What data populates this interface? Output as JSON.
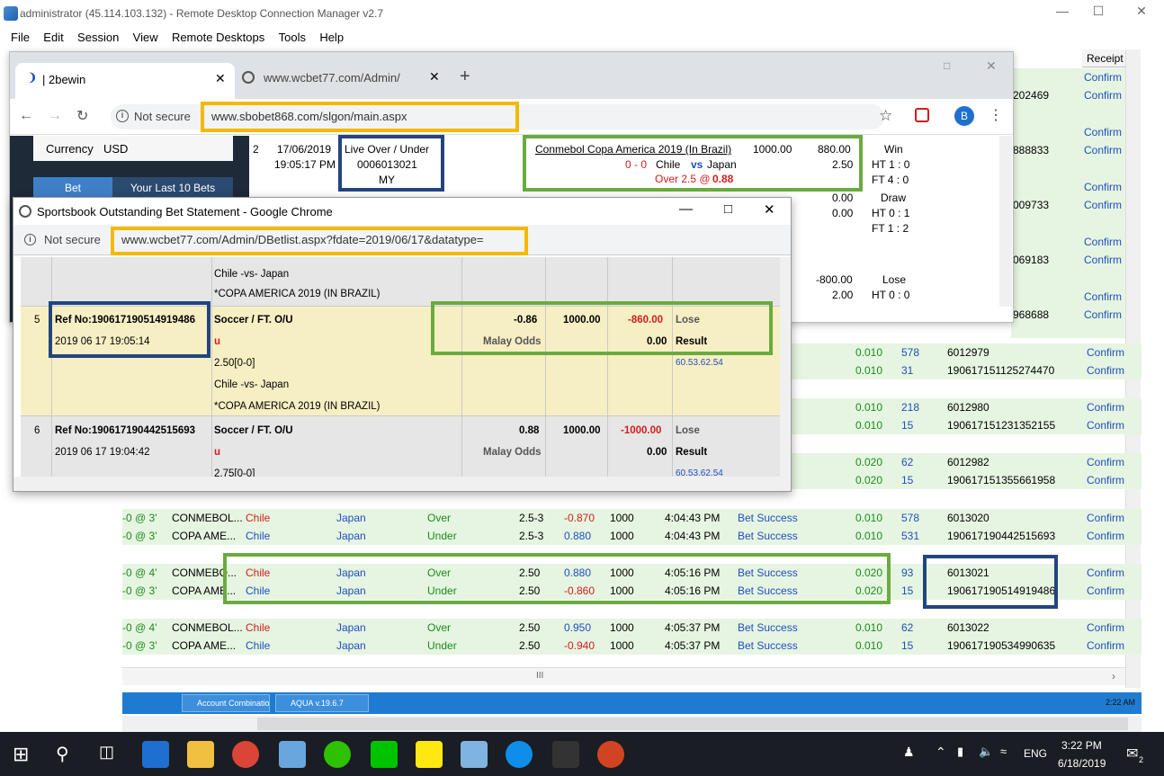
{
  "rdcm": {
    "title": "administrator (45.114.103.132) - Remote Desktop Connection Manager v2.7",
    "menu": [
      "File",
      "Edit",
      "Session",
      "View",
      "Remote Desktops",
      "Tools",
      "Help"
    ],
    "receipt_header": "Receipt",
    "receipt_links": [
      "Confirm",
      "Confirm",
      "Confirm",
      "Confirm",
      "Confirm",
      "Confirm",
      "Confirm",
      "Confirm",
      "Confirm",
      "Confirm"
    ],
    "side_numbers": [
      "202469",
      "888833",
      "009733",
      "069183",
      "968688"
    ],
    "rows": [
      {
        "a": "",
        "b": "",
        "c": "",
        "d": "",
        "e": "",
        "f": "",
        "g": "",
        "h": "",
        "i": "",
        "j": "",
        "k": "0.010",
        "l": "578",
        "m": "6012979",
        "n": "Confirm"
      },
      {
        "a": "",
        "b": "",
        "c": "",
        "d": "",
        "e": "",
        "f": "",
        "g": "",
        "h": "",
        "i": "",
        "j": "",
        "k": "0.010",
        "l": "31",
        "m": "190617151125274470",
        "n": "Confirm"
      },
      {
        "a": "",
        "b": "",
        "c": "",
        "d": "",
        "e": "",
        "f": "",
        "g": "",
        "h": "",
        "i": "",
        "j": "",
        "k": "0.010",
        "l": "218",
        "m": "6012980",
        "n": "Confirm"
      },
      {
        "a": "",
        "b": "",
        "c": "",
        "d": "",
        "e": "",
        "f": "",
        "g": "",
        "h": "",
        "i": "",
        "j": "",
        "k": "0.010",
        "l": "15",
        "m": "190617151231352155",
        "n": "Confirm"
      },
      {
        "a": "",
        "b": "",
        "c": "",
        "d": "",
        "e": "",
        "f": "",
        "g": "",
        "h": "",
        "i": "",
        "j": "",
        "k": "0.020",
        "l": "62",
        "m": "6012982",
        "n": "Confirm"
      },
      {
        "a": "",
        "b": "",
        "c": "",
        "d": "",
        "e": "",
        "f": "",
        "g": "",
        "h": "",
        "i": "",
        "j": "",
        "k": "0.020",
        "l": "15",
        "m": "190617151355661958",
        "n": "Confirm"
      },
      {
        "a": "-0 @ 3'",
        "b": "CONMEBOL...",
        "c": "Chile",
        "d": "Japan",
        "e": "Over",
        "f": "2.5-3",
        "g": "-0.870",
        "h": "1000",
        "i": "4:04:43 PM",
        "j": "Bet Success",
        "k": "0.010",
        "l": "578",
        "m": "6013020",
        "n": "Confirm"
      },
      {
        "a": "-0 @ 3'",
        "b": "COPA AME...",
        "c": "Chile",
        "d": "Japan",
        "e": "Under",
        "f": "2.5-3",
        "g": "0.880",
        "h": "1000",
        "i": "4:04:43 PM",
        "j": "Bet Success",
        "k": "0.010",
        "l": "531",
        "m": "190617190442515693",
        "n": "Confirm"
      },
      {
        "a": "-0 @ 4'",
        "b": "CONMEBO...",
        "c": "Chile",
        "d": "Japan",
        "e": "Over",
        "f": "2.50",
        "g": "0.880",
        "h": "1000",
        "i": "4:05:16 PM",
        "j": "Bet Success",
        "k": "0.020",
        "l": "93",
        "m": "6013021",
        "n": "Confirm"
      },
      {
        "a": "-0 @ 3'",
        "b": "COPA AME...",
        "c": "Chile",
        "d": "Japan",
        "e": "Under",
        "f": "2.50",
        "g": "-0.860",
        "h": "1000",
        "i": "4:05:16 PM",
        "j": "Bet Success",
        "k": "0.020",
        "l": "15",
        "m": "190617190514919486",
        "n": "Confirm"
      },
      {
        "a": "-0 @ 4'",
        "b": "CONMEBOL...",
        "c": "Chile",
        "d": "Japan",
        "e": "Over",
        "f": "2.50",
        "g": "0.950",
        "h": "1000",
        "i": "4:05:37 PM",
        "j": "Bet Success",
        "k": "0.010",
        "l": "62",
        "m": "6013022",
        "n": "Confirm"
      },
      {
        "a": "-0 @ 3'",
        "b": "COPA AME...",
        "c": "Chile",
        "d": "Japan",
        "e": "Under",
        "f": "2.50",
        "g": "-0.940",
        "h": "1000",
        "i": "4:05:37 PM",
        "j": "Bet Success",
        "k": "0.010",
        "l": "15",
        "m": "190617190534990635",
        "n": "Confirm"
      }
    ],
    "hscroll_mark": "III",
    "inner_taskbar": [
      "Account Combinatio...",
      "AQUA v.19.6.7"
    ],
    "inner_tray_time": "2:22 AM"
  },
  "chrome": {
    "tab1": "| 2bewin",
    "tab2": "www.wcbet77.com/Admin/",
    "new_tab": "+",
    "not_secure": "Not secure",
    "url": "www.sbobet868.com/slgon/main.aspx",
    "profile": "B",
    "currency_label": "Currency",
    "currency_value": "USD",
    "btn_bet": "Bet",
    "btn_last": "Your Last 10 Bets",
    "bet": {
      "no": "2",
      "date": "17/06/2019",
      "time": "19:05:17 PM",
      "type": "Live Over / Under",
      "id": "0006013021",
      "odds_type": "MY",
      "league": "Conmebol Copa America 2019 (In Brazil)",
      "score": "0 - 0",
      "home": "Chile",
      "vs": "vs",
      "away": "Japan",
      "pick": "Over 2.5 @",
      "odds": "0.88",
      "stake": "1000.00",
      "win_amt": "880.00",
      "hdp": "2.50",
      "result": "Win",
      "ht": "HT 1 : 0",
      "ft": "FT 4 : 0"
    },
    "row2": {
      "a": "0.00",
      "b": "0.00",
      "result": "Draw",
      "ht": "HT 0 : 1",
      "ft": "FT 1 : 2"
    },
    "row3": {
      "a": "-800.00",
      "b": "2.00",
      "result": "Lose",
      "ht": "HT 0 : 0"
    }
  },
  "popup": {
    "title": "Sportsbook Outstanding Bet Statement - Google Chrome",
    "not_secure": "Not secure",
    "url": "www.wcbet77.com/Admin/DBetlist.aspx?fdate=2019/06/17&datatype=",
    "row0": {
      "match": "Chile -vs- Japan",
      "league": "*COPA AMERICA 2019 (IN BRAZIL)"
    },
    "row5": {
      "no": "5",
      "ref": "Ref No:190617190514919486",
      "date": "2019 06 17 19:05:14",
      "sport": "Soccer / FT. O/U",
      "pick": "u",
      "hdp": "2.50[0-0]",
      "match": "Chile -vs- Japan",
      "league": "*COPA AMERICA 2019 (IN BRAZIL)",
      "odds": "-0.86",
      "odds_type": "Malay Odds",
      "stake": "1000.00",
      "winloss": "-860.00",
      "com": "0.00",
      "status": "Lose",
      "result": "Result",
      "ip": "60.53.62.54"
    },
    "row6": {
      "no": "6",
      "ref": "Ref No:190617190442515693",
      "date": "2019 06 17 19:04:42",
      "sport": "Soccer / FT. O/U",
      "pick": "u",
      "hdp": "2.75[0-0]",
      "odds": "0.88",
      "odds_type": "Malay Odds",
      "stake": "1000.00",
      "winloss": "-1000.00",
      "com": "0.00",
      "status": "Lose",
      "result": "Result",
      "ip": "60.53.62.54"
    }
  },
  "taskbar": {
    "time": "3:22 PM",
    "date": "6/18/2019",
    "lang": "ENG",
    "notif": "2"
  },
  "colors": {
    "highlight_orange": "#f5b800",
    "highlight_green": "#6aab3f",
    "highlight_navy": "#23457e",
    "row_green": "#e6f5e1",
    "row_yellow": "#f7efc4"
  }
}
